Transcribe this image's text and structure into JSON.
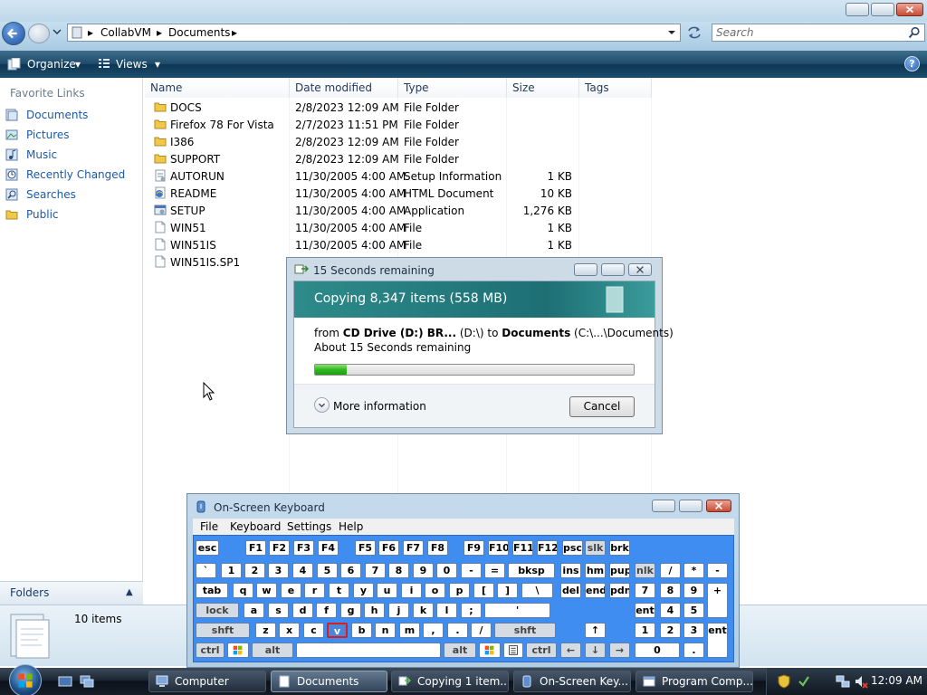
{
  "window": {
    "breadcrumb": [
      "CollabVM",
      "Documents"
    ],
    "search_placeholder": "Search"
  },
  "toolbar": {
    "organize_label": "Organize",
    "views_label": "Views"
  },
  "nav": {
    "header": "Favorite Links",
    "items": [
      {
        "label": "Documents",
        "icon": "documents-icon"
      },
      {
        "label": "Pictures",
        "icon": "pictures-icon"
      },
      {
        "label": "Music",
        "icon": "music-icon"
      },
      {
        "label": "Recently Changed",
        "icon": "recently-changed-icon"
      },
      {
        "label": "Searches",
        "icon": "searches-icon"
      },
      {
        "label": "Public",
        "icon": "folder-icon"
      }
    ],
    "folders_label": "Folders"
  },
  "filelist": {
    "columns": [
      "Name",
      "Date modified",
      "Type",
      "Size",
      "Tags"
    ],
    "rows": [
      {
        "name": "DOCS",
        "date": "2/8/2023 12:09 AM",
        "type": "File Folder",
        "size": "",
        "icon": "folder-icon"
      },
      {
        "name": "Firefox 78 For Vista",
        "date": "2/7/2023 11:51 PM",
        "type": "File Folder",
        "size": "",
        "icon": "folder-icon"
      },
      {
        "name": "I386",
        "date": "2/8/2023 12:09 AM",
        "type": "File Folder",
        "size": "",
        "icon": "folder-icon"
      },
      {
        "name": "SUPPORT",
        "date": "2/8/2023 12:09 AM",
        "type": "File Folder",
        "size": "",
        "icon": "folder-icon"
      },
      {
        "name": "AUTORUN",
        "date": "11/30/2005 4:00 AM",
        "type": "Setup Information",
        "size": "1 KB",
        "icon": "setup-info-icon"
      },
      {
        "name": "README",
        "date": "11/30/2005 4:00 AM",
        "type": "HTML Document",
        "size": "10 KB",
        "icon": "html-doc-icon"
      },
      {
        "name": "SETUP",
        "date": "11/30/2005 4:00 AM",
        "type": "Application",
        "size": "1,276 KB",
        "icon": "application-icon"
      },
      {
        "name": "WIN51",
        "date": "11/30/2005 4:00 AM",
        "type": "File",
        "size": "1 KB",
        "icon": "file-icon"
      },
      {
        "name": "WIN51IS",
        "date": "11/30/2005 4:00 AM",
        "type": "File",
        "size": "1 KB",
        "icon": "file-icon"
      },
      {
        "name": "WIN51IS.SP1",
        "date": "",
        "type": "",
        "size": "",
        "icon": "file-icon"
      }
    ]
  },
  "details": {
    "item_count": "10 items"
  },
  "copy_dialog": {
    "title": "15 Seconds remaining",
    "heading": "Copying 8,347 items (558 MB)",
    "from_label": "from",
    "source_name": "CD Drive (D:) BR...",
    "source_path": "(D:\\)",
    "to_label": "to",
    "dest_name": "Documents",
    "dest_path": "(C:\\...\\Documents)",
    "time_remaining": "About 15 Seconds remaining",
    "progress": 0.1,
    "more_info_label": "More information",
    "cancel_label": "Cancel"
  },
  "osk": {
    "title": "On-Screen Keyboard",
    "menu": [
      "File",
      "Keyboard",
      "Settings",
      "Help"
    ],
    "rows": [
      [
        "esc",
        "F1",
        "F2",
        "F3",
        "F4",
        "F5",
        "F6",
        "F7",
        "F8",
        "F9",
        "F10",
        "F11",
        "F12",
        "psc",
        "slk",
        "brk"
      ],
      [
        "`",
        "1",
        "2",
        "3",
        "4",
        "5",
        "6",
        "7",
        "8",
        "9",
        "0",
        "-",
        "=",
        "bksp",
        "ins",
        "hm",
        "pup",
        "nlk",
        "/",
        "*",
        "-"
      ],
      [
        "tab",
        "q",
        "w",
        "e",
        "r",
        "t",
        "y",
        "u",
        "i",
        "o",
        "p",
        "[",
        "]",
        "\\",
        "del",
        "end",
        "pdn",
        "7",
        "8",
        "9",
        "+"
      ],
      [
        "lock",
        "a",
        "s",
        "d",
        "f",
        "g",
        "h",
        "j",
        "k",
        "l",
        ";",
        "'",
        "ent",
        "4",
        "5",
        "6"
      ],
      [
        "shft",
        "z",
        "x",
        "c",
        "v",
        "b",
        "n",
        "m",
        ",",
        ".",
        "/",
        "shft",
        "↑",
        "1",
        "2",
        "3",
        "ent"
      ],
      [
        "ctrl",
        "alt",
        "alt",
        "ctrl",
        "←",
        "↓",
        "→",
        "0",
        "."
      ]
    ],
    "selected_key": "v"
  },
  "taskbar": {
    "items": [
      {
        "label": "Computer",
        "active": false
      },
      {
        "label": "Documents",
        "active": true
      },
      {
        "label": "Copying 1 item...",
        "active": false
      },
      {
        "label": "On-Screen Key...",
        "active": false
      },
      {
        "label": "Program Comp...",
        "active": false
      }
    ],
    "clock": "12:09 AM"
  }
}
